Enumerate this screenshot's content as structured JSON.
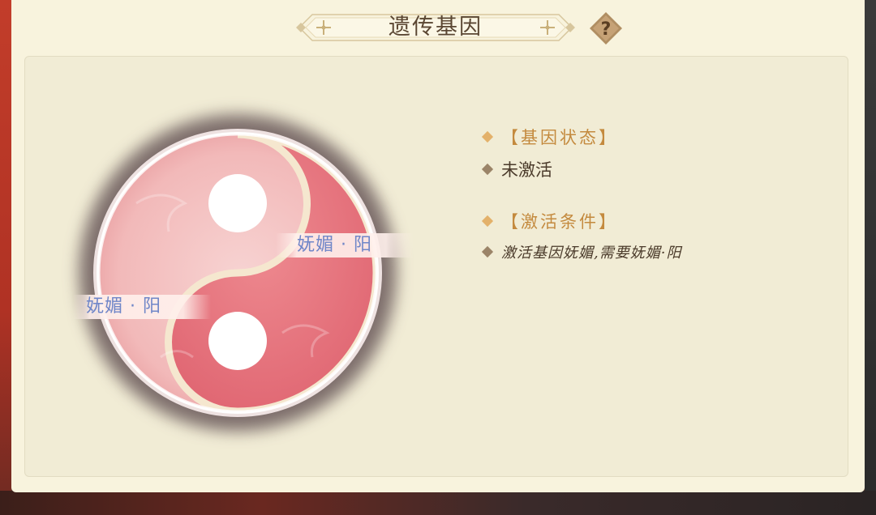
{
  "header": {
    "title": "遗传基因",
    "help_label": "?"
  },
  "gene": {
    "right_tag": "妩媚 · 阳",
    "left_tag": "妩媚 · 阳"
  },
  "info": {
    "status_heading": "【基因状态】",
    "status_value": "未激活",
    "condition_heading": "【激活条件】",
    "condition_value": "激活基因妩媚,需要妩媚·阳"
  },
  "colors": {
    "panel_bg": "#f8f3dd",
    "accent_gold": "#c48a3e",
    "tag_blue": "#6f86c8",
    "yinyang_pink": "#e8747e"
  }
}
